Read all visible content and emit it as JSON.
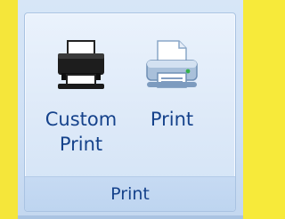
{
  "ribbon": {
    "group": {
      "title": "Print",
      "buttons": [
        {
          "label": "Custom\nPrint",
          "icon": "printer-black-icon"
        },
        {
          "label": "Print",
          "icon": "printer-paper-icon"
        }
      ]
    }
  },
  "colors": {
    "background_yellow": "#f7ea3a",
    "ribbon_blue": "#d7e6f7",
    "label_text": "#15428b"
  }
}
